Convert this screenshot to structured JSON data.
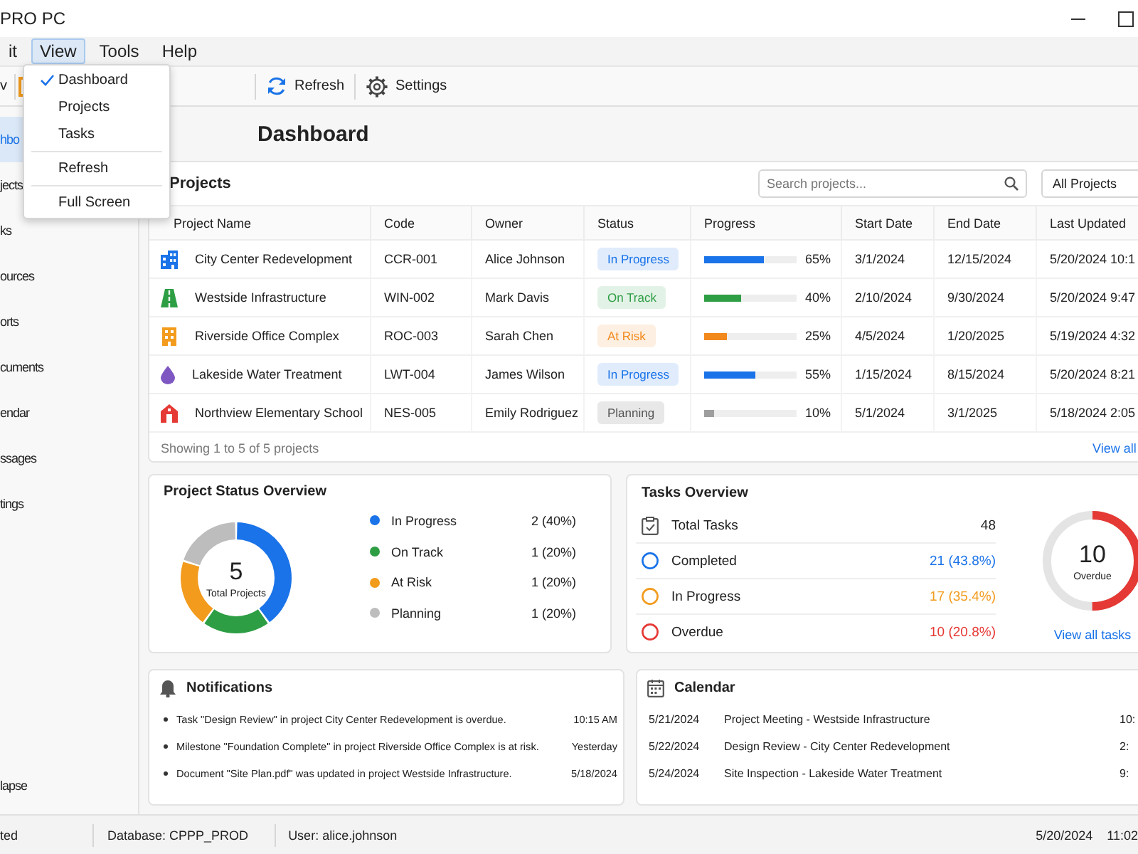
{
  "window": {
    "title": "PRO PC"
  },
  "menu_bar": [
    {
      "label": "it",
      "selected": false
    },
    {
      "label": "View",
      "selected": true
    },
    {
      "label": "Tools",
      "selected": false
    },
    {
      "label": "Help",
      "selected": false
    }
  ],
  "toolbar": {
    "left_label": "v",
    "buttons": [
      {
        "kind": "refresh",
        "label": "Refresh"
      },
      {
        "kind": "settings",
        "label": "Settings"
      }
    ]
  },
  "sidebar": {
    "items": [
      {
        "label": "hbo",
        "selected": true
      },
      {
        "label": "jects",
        "selected": false
      },
      {
        "label": "ks",
        "selected": false
      },
      {
        "label": "ources",
        "selected": false
      },
      {
        "label": "orts",
        "selected": false
      },
      {
        "label": "cuments",
        "selected": false
      },
      {
        "label": "endar",
        "selected": false
      },
      {
        "label": "ssages",
        "selected": false
      },
      {
        "label": "tings",
        "selected": false
      }
    ],
    "collapse_label": "lapse"
  },
  "page_title": "Dashboard",
  "projects": {
    "title": "Projects",
    "search": {
      "placeholder": "Search projects..."
    },
    "filter": "All Projects",
    "columns": [
      "Project Name",
      "Code",
      "Owner",
      "Status",
      "Progress",
      "Start Date",
      "End Date",
      "Last Updated"
    ],
    "rows": [
      {
        "kind": "building",
        "name": "City Center Redevelopment",
        "code": "CCR-001",
        "owner": "Alice Johnson",
        "status": {
          "label": "In Progress",
          "color": "#1a73e8"
        },
        "progress": {
          "level": 0.65,
          "text": "65%"
        },
        "start": "3/1/2024",
        "end": "12/15/2024",
        "updated": "5/20/2024 10:1"
      },
      {
        "kind": "road",
        "name": "Westside Infrastructure",
        "code": "WIN-002",
        "owner": "Mark Davis",
        "status": {
          "label": "On Track",
          "color": "#2e9e45"
        },
        "progress": {
          "level": 0.4,
          "text": "40%"
        },
        "start": "2/10/2024",
        "end": "9/30/2024",
        "updated": "5/20/2024 9:47"
      },
      {
        "kind": "office",
        "name": "Riverside Office Complex",
        "code": "ROC-003",
        "owner": "Sarah Chen",
        "status": {
          "label": "At Risk",
          "color": "#f2891d"
        },
        "progress": {
          "level": 0.25,
          "text": "25%"
        },
        "start": "4/5/2024",
        "end": "1/20/2025",
        "updated": "5/19/2024 4:32"
      },
      {
        "kind": "water",
        "name": "Lakeside Water Treatment",
        "code": "LWT-004",
        "owner": "James Wilson",
        "status": {
          "label": "In Progress",
          "color": "#1a73e8"
        },
        "progress": {
          "level": 0.55,
          "text": "55%"
        },
        "start": "1/15/2024",
        "end": "8/15/2024",
        "updated": "5/20/2024 8:21"
      },
      {
        "kind": "school",
        "name": "Northview Elementary School",
        "code": "NES-005",
        "owner": "Emily Rodriguez",
        "status": {
          "label": "Planning",
          "color": "#555555"
        },
        "progress": {
          "level": 0.1,
          "text": "10%"
        },
        "start": "5/1/2024",
        "end": "3/1/2025",
        "updated": "5/18/2024 2:05"
      }
    ],
    "footer": "Showing 1 to 5 of 5 projects",
    "view_all": "View all"
  },
  "project_status": {
    "title": "Project Status Overview",
    "total": "5",
    "total_label": "Total Projects",
    "chart_data": {
      "type": "donut",
      "categories": [
        "In Progress",
        "On Track",
        "At Risk",
        "Planning"
      ],
      "values": [
        40,
        20,
        20,
        20
      ]
    },
    "legend": [
      {
        "value": "2 (40%)",
        "color": "#1a73e8"
      },
      {
        "value": "1 (20%)",
        "color": "#2e9e45"
      },
      {
        "value": "1 (20%)",
        "color": "#f29b1d"
      },
      {
        "value": "1 (20%)",
        "color": "#bdbdbd"
      }
    ]
  },
  "tasks": {
    "title": "Tasks Overview",
    "items": [
      {
        "kind": "total",
        "label": "Total Tasks",
        "value": "48"
      },
      {
        "kind": "status",
        "label": "Completed",
        "value": "21 (43.8%)",
        "color": "#1a73e8"
      },
      {
        "kind": "status",
        "label": "In Progress",
        "value": "17 (35.4%)",
        "color": "#f29b1d"
      },
      {
        "kind": "status",
        "label": "Overdue",
        "value": "10 (20.8%)",
        "color": "#e53935"
      }
    ],
    "ring": {
      "value": "10",
      "label": "Overdue",
      "level": 0.5
    },
    "link": "View all tasks"
  },
  "notifications": {
    "title": "Notifications",
    "items": [
      {
        "text": "Task \"Design Review\" in project City Center Redevelopment is overdue.",
        "time": "10:15 AM"
      },
      {
        "text": "Milestone \"Foundation Complete\" in project Riverside Office Complex is at risk.",
        "time": "Yesterday"
      },
      {
        "text": "Document \"Site Plan.pdf\" was updated in project Westside Infrastructure.",
        "time": "5/18/2024"
      }
    ]
  },
  "calendar": {
    "title": "Calendar",
    "items": [
      {
        "date": "5/21/2024",
        "event": "Project Meeting - Westside Infrastructure",
        "time": "10:"
      },
      {
        "date": "5/22/2024",
        "event": "Design Review - City Center Redevelopment",
        "time": "2:"
      },
      {
        "date": "5/24/2024",
        "event": "Site Inspection - Lakeside Water Treatment",
        "time": "9:"
      }
    ]
  },
  "status_bar": {
    "connection": "ted",
    "database": "Database: CPPP_PROD",
    "user": "User: alice.johnson",
    "date": "5/20/2024",
    "time": "11:02"
  },
  "view_menu": {
    "items": [
      {
        "kind": "item",
        "label": "Dashboard",
        "checked": true
      },
      {
        "kind": "item",
        "label": "Projects",
        "checked": false
      },
      {
        "kind": "item",
        "label": "Tasks",
        "checked": false
      },
      {
        "kind": "separator"
      },
      {
        "kind": "item",
        "label": "Refresh",
        "checked": false
      },
      {
        "kind": "separator"
      },
      {
        "kind": "item",
        "label": "Full Screen",
        "checked": false
      }
    ]
  }
}
